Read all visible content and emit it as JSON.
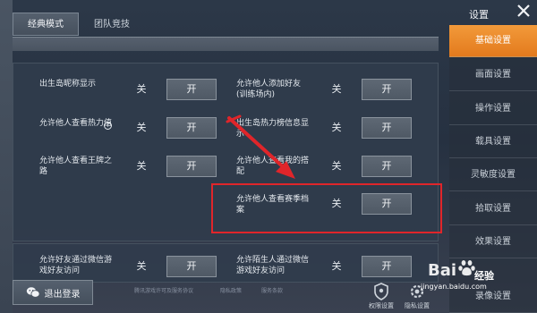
{
  "mode_tabs": [
    {
      "label": "经典模式",
      "active": true
    },
    {
      "label": "团队竞技",
      "active": false
    }
  ],
  "toggle_labels": {
    "off": "关",
    "on": "开"
  },
  "settings": [
    {
      "label": "出生岛昵称显示"
    },
    {
      "label": "允许他人添加好友(训练场内)"
    },
    {
      "label": "允许他人查看热力值"
    },
    {
      "label": "出生岛热力榜信息显示"
    },
    {
      "label": "允许他人查看王牌之路"
    },
    {
      "label": "允许他人查看我的搭配"
    },
    {
      "label": "允许他人查看赛季档案"
    },
    {
      "label": "允许好友通过微信游戏好友访问"
    },
    {
      "label": "允许陌生人通过微信游戏好友访问"
    }
  ],
  "exit_button": {
    "label": "退出登录"
  },
  "faint_links": [
    "腾讯游戏许可及服务协议",
    "隐私政策",
    "服务条款"
  ],
  "bottom_icons": [
    {
      "icon": "shield-icon",
      "label": "权限设置"
    },
    {
      "icon": "gear-icon",
      "label": "隐私设置"
    }
  ],
  "sidebar": {
    "title": "设置",
    "items": [
      {
        "label": "基础设置",
        "active": true
      },
      {
        "label": "画面设置",
        "active": false
      },
      {
        "label": "操作设置",
        "active": false
      },
      {
        "label": "载具设置",
        "active": false
      },
      {
        "label": "灵敏度设置",
        "active": false
      },
      {
        "label": "拾取设置",
        "active": false
      },
      {
        "label": "效果设置",
        "active": false
      },
      {
        "label": "录像设置",
        "active": false
      }
    ]
  },
  "watermark": {
    "brand": "Bai",
    "text": "经验",
    "url": "jingyan.baidu.com"
  },
  "colors": {
    "accent": "#e98a2c",
    "highlight": "#e0252a",
    "panel": "#303c4c"
  }
}
